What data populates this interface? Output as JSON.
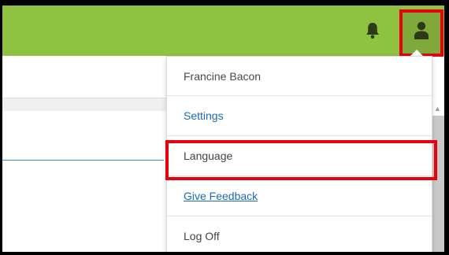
{
  "colors": {
    "topbar": "#8fc240",
    "user_button": "#7fa93a",
    "icon_dark": "#2d3a16",
    "highlight": "#e8000b",
    "link": "#1a6bb8",
    "background_accent": "#2c8fd8"
  },
  "topbar": {
    "notifications_icon": "bell-icon",
    "user_icon": "user-icon"
  },
  "user_menu": {
    "user_name": "Francine Bacon",
    "items": [
      {
        "label": "Settings"
      },
      {
        "label": "Language"
      },
      {
        "label": "Give Feedback"
      },
      {
        "label": "Log Off"
      }
    ]
  },
  "background": {
    "scroll_up_arrow": "▲"
  }
}
